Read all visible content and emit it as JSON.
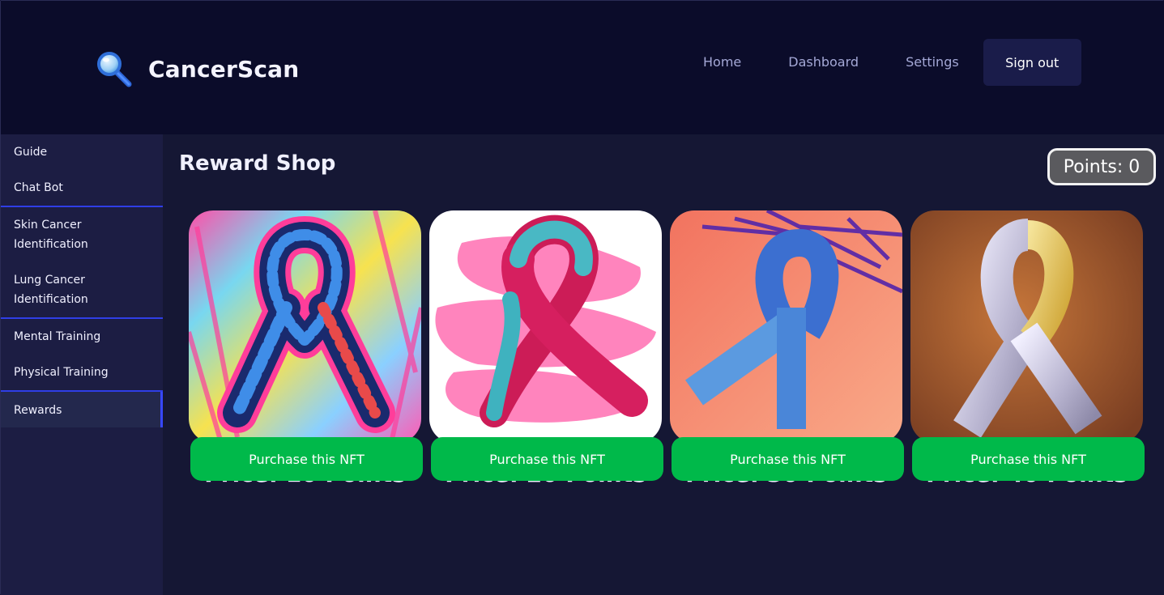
{
  "app": {
    "name": "CancerScan",
    "logo_icon": "magnifier-icon"
  },
  "nav": {
    "home": "Home",
    "dashboard": "Dashboard",
    "settings": "Settings",
    "signout": "Sign out"
  },
  "sidebar": {
    "items": [
      {
        "label": "Guide"
      },
      {
        "label": "Chat Bot"
      },
      {
        "label": "Skin Cancer Identification"
      },
      {
        "label": "Lung Cancer Identification"
      },
      {
        "label": "Mental Training"
      },
      {
        "label": "Physical Training"
      },
      {
        "label": "Rewards",
        "active": true
      }
    ]
  },
  "main": {
    "title": "Reward Shop",
    "points": "Points: 0",
    "cards": [
      {
        "price": "Price: 10 Points",
        "button": "Purchase this NFT",
        "image": "ribbon-art-neon-icon"
      },
      {
        "price": "Price: 20 Points",
        "button": "Purchase this NFT",
        "image": "ribbon-art-pink-teal-icon"
      },
      {
        "price": "Price: 30 Points",
        "button": "Purchase this NFT",
        "image": "ribbon-blue-on-coral-icon"
      },
      {
        "price": "Price: 40 Points",
        "button": "Purchase this NFT",
        "image": "ribbon-silver-gold-icon"
      }
    ]
  },
  "colors": {
    "header_bg": "#0b0c2a",
    "sidebar_bg": "#1c1d43",
    "main_bg": "#151734",
    "accent_blue": "#3747ff",
    "button_green": "#00b94a"
  }
}
